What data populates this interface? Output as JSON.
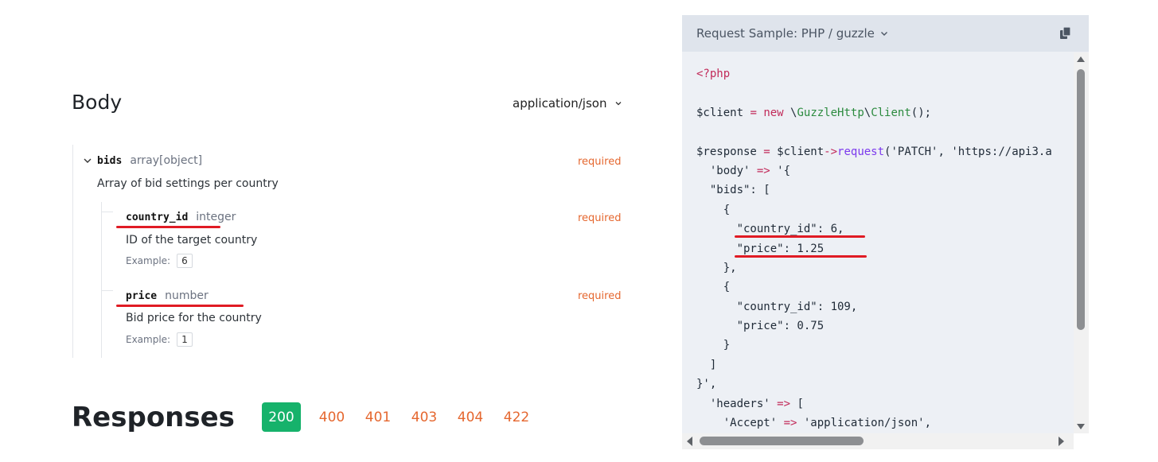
{
  "body_section": {
    "title": "Body",
    "media_type": "application/json"
  },
  "schema": {
    "bids": {
      "name": "bids",
      "type": "array[object]",
      "required": "required",
      "description": "Array of bid settings per country"
    },
    "country_id": {
      "name": "country_id",
      "type": "integer",
      "required": "required",
      "description": "ID of the target country",
      "example_label": "Example:",
      "example_value": "6"
    },
    "price": {
      "name": "price",
      "type": "number",
      "required": "required",
      "description": "Bid price for the country",
      "example_label": "Example:",
      "example_value": "1"
    }
  },
  "responses": {
    "title": "Responses",
    "codes": [
      "200",
      "400",
      "401",
      "403",
      "404",
      "422"
    ],
    "active_code": "200"
  },
  "request_sample": {
    "title": "Request Sample: PHP / guzzle",
    "lines": [
      "<?php",
      "",
      "$client = new \\GuzzleHttp\\Client();",
      "",
      "$response = $client->request('PATCH', 'https://api3.a",
      "  'body' => '{",
      "  \"bids\": [",
      "    {",
      "      \"country_id\": 6,",
      "      \"price\": 1.25",
      "    },",
      "    {",
      "      \"country_id\": 109,",
      "      \"price\": 0.75",
      "    }",
      "  ]",
      "}',",
      "  'headers' => [",
      "    'Accept' => 'application/json',"
    ]
  },
  "colors": {
    "required": "#e5672f",
    "success": "#16b26b",
    "highlight": "#e01b24",
    "panel_bg": "#edf0f5",
    "panel_header": "#dfe4ec"
  },
  "icons": {
    "copy": "copy-icon",
    "chevron": "chevron-down-icon",
    "expand": "chevron-down-icon"
  }
}
